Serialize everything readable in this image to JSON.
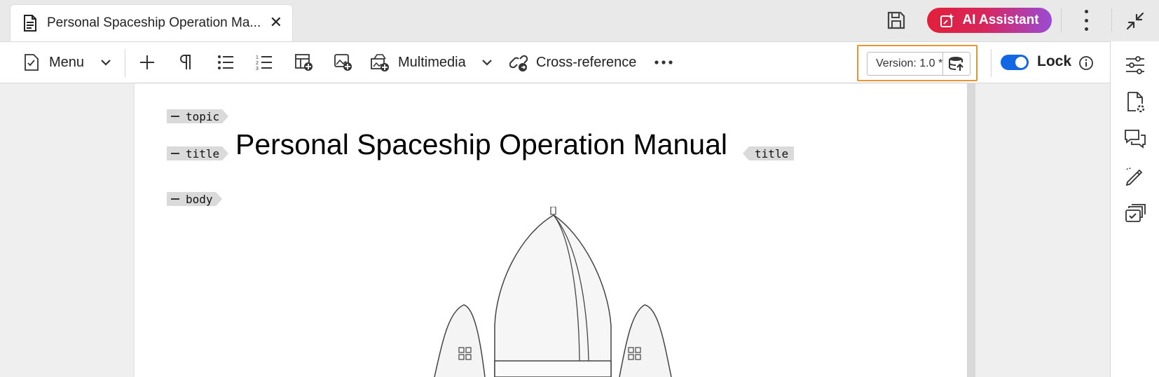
{
  "tab": {
    "title": "Personal Spaceship Operation Ma...",
    "close_glyph": "✕",
    "icon": "document-icon"
  },
  "header": {
    "save_icon": "save-icon",
    "ai_button_label": "AI Assistant",
    "ai_gradient": [
      "#e1203a",
      "#9a4bd6"
    ],
    "more_icon": "kebab-icon",
    "collapse_icon": "collapse-icon"
  },
  "toolbar": {
    "menu_label": "Menu",
    "multimedia_label": "Multimedia",
    "cross_reference_label": "Cross-reference",
    "version_label": "Version: 1.0 *",
    "version_highlight_color": "#e8962e",
    "lock_label": "Lock",
    "lock_enabled": true,
    "toggle_color": "#1467e3",
    "icons": [
      "checklist-icon",
      "chevron-down-icon",
      "plus-icon",
      "paragraph-icon",
      "bulleted-list-icon",
      "numbered-list-icon",
      "insert-table-icon",
      "insert-image-icon",
      "multimedia-icon",
      "cross-reference-icon",
      "more-horizontal-icon",
      "database-upload-icon",
      "info-icon"
    ]
  },
  "rail": {
    "icons": [
      "properties-icon",
      "file-settings-icon",
      "comments-icon",
      "edit-pen-icon",
      "review-icon"
    ]
  },
  "document": {
    "tags": {
      "topic": "topic",
      "title_open": "title",
      "title_close": "title",
      "body": "body"
    },
    "title_text": "Personal Spaceship Operation Manual",
    "image": "spaceship-illustration"
  }
}
